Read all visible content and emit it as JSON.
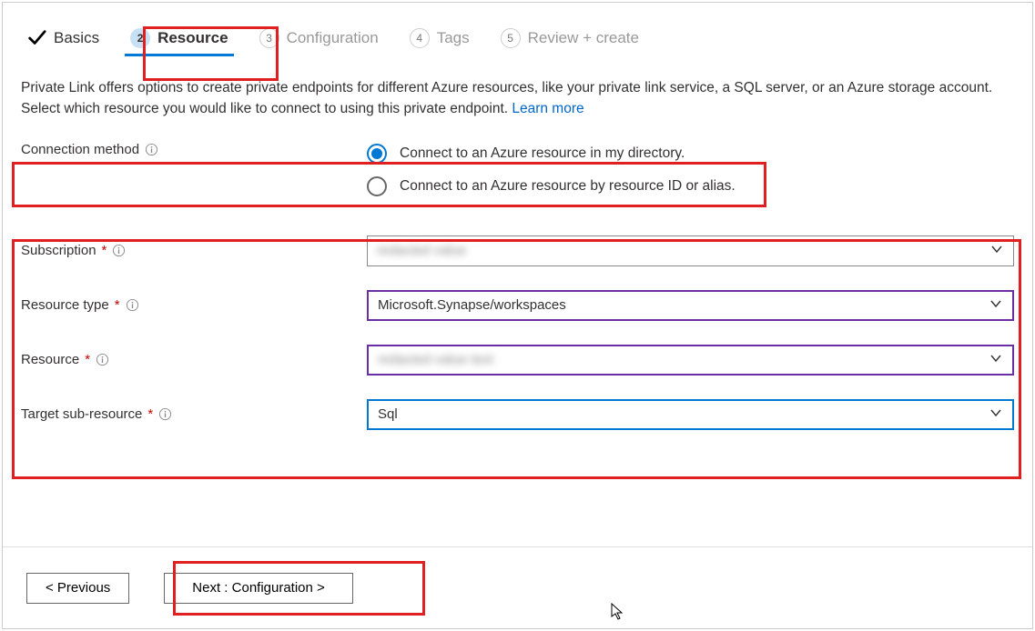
{
  "tabs": {
    "basics": "Basics",
    "resource": {
      "num": "2",
      "label": "Resource"
    },
    "configuration": {
      "num": "3",
      "label": "Configuration"
    },
    "tags": {
      "num": "4",
      "label": "Tags"
    },
    "review": {
      "num": "5",
      "label": "Review + create"
    }
  },
  "description": {
    "text": "Private Link offers options to create private endpoints for different Azure resources, like your private link service, a SQL server, or an Azure storage account. Select which resource you would like to connect to using this private endpoint.  ",
    "learn_more": "Learn more"
  },
  "connection_method": {
    "label": "Connection method",
    "options": {
      "my_directory": "Connect to an Azure resource in my directory.",
      "by_id": "Connect to an Azure resource by resource ID or alias."
    },
    "selected": "my_directory"
  },
  "fields": {
    "subscription": {
      "label": "Subscription",
      "value": "redacted value"
    },
    "resource_type": {
      "label": "Resource type",
      "value": "Microsoft.Synapse/workspaces"
    },
    "resource": {
      "label": "Resource",
      "value": "redacted value text"
    },
    "target_sub_resource": {
      "label": "Target sub-resource",
      "value": "Sql"
    }
  },
  "buttons": {
    "previous": "< Previous",
    "next": "Next : Configuration >"
  }
}
